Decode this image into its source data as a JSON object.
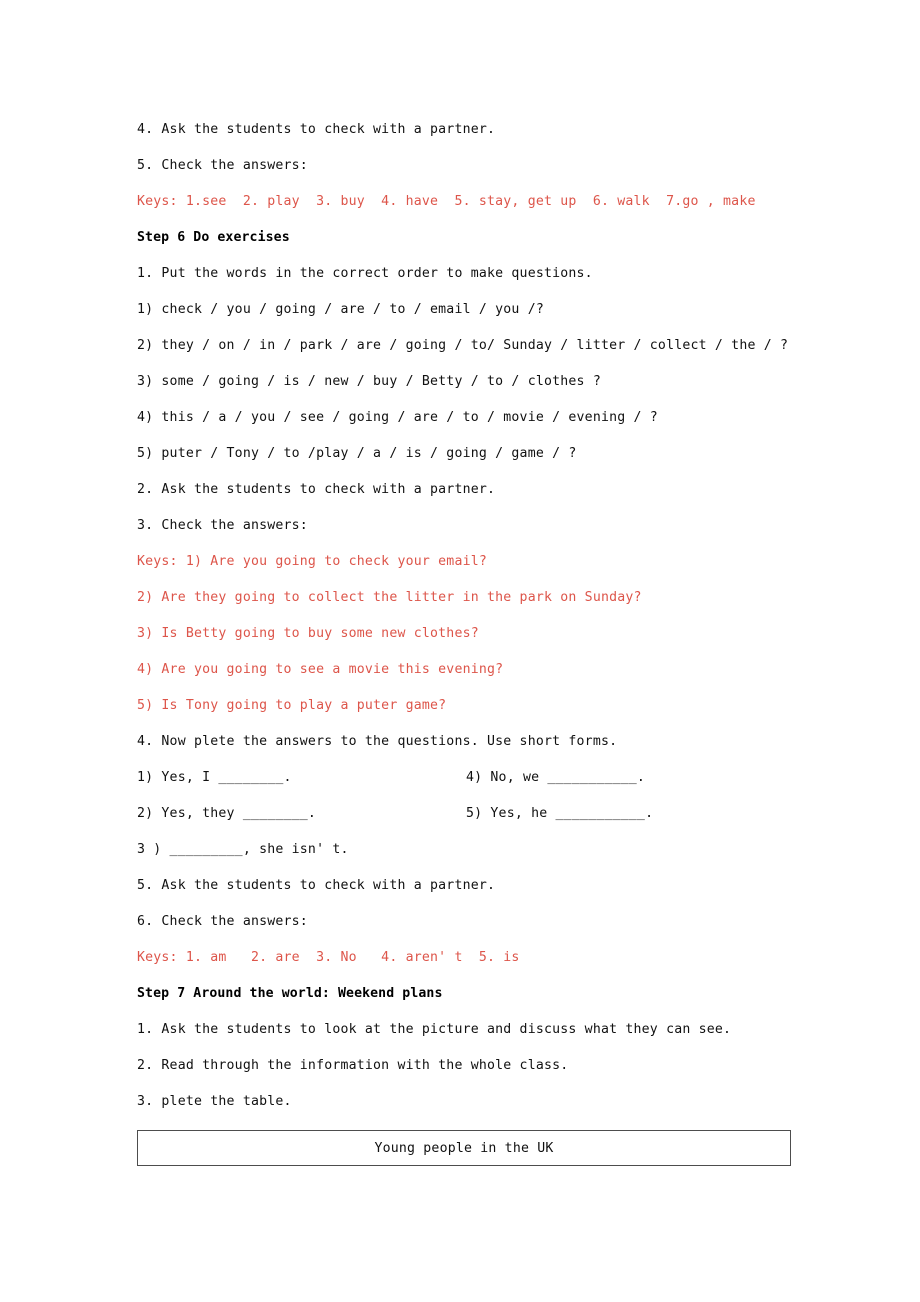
{
  "document": {
    "lines": [
      {
        "id": "l1",
        "text": "4. Ask the students to check with a partner.",
        "style": "plain"
      },
      {
        "id": "l2",
        "text": "5. Check the answers:",
        "style": "plain"
      },
      {
        "id": "l3",
        "text": "Keys: 1.see  2. play  3. buy  4. have  5. stay, get up  6. walk  7.go , make",
        "style": "red"
      },
      {
        "id": "l4",
        "text": "Step 6 Do exercises",
        "style": "bold"
      },
      {
        "id": "l5",
        "text": "1. Put the words in the correct order to make questions.",
        "style": "plain"
      },
      {
        "id": "l6",
        "text": "1) check / you / going / are / to / email / you /?",
        "style": "plain"
      },
      {
        "id": "l7",
        "text": "2) they / on / in / park / are / going / to/ Sunday / litter / collect / the / ?",
        "style": "plain"
      },
      {
        "id": "l8",
        "text": "3) some / going / is / new / buy / Betty / to / clothes ?",
        "style": "plain"
      },
      {
        "id": "l9",
        "text": "4) this / a / you / see / going / are / to / movie / evening / ?",
        "style": "plain"
      },
      {
        "id": "l10",
        "text": "5) puter / Tony / to /play / a / is / going / game / ?",
        "style": "plain"
      },
      {
        "id": "l11",
        "text": "2. Ask the students to check with a partner.",
        "style": "plain"
      },
      {
        "id": "l12",
        "text": "3. Check the answers:",
        "style": "plain"
      },
      {
        "id": "l13",
        "text": "Keys: 1) Are you going to check your email?",
        "style": "red"
      },
      {
        "id": "l14",
        "text": "2) Are they going to collect the litter in the park on Sunday?",
        "style": "red"
      },
      {
        "id": "l15",
        "text": "3) Is Betty going to buy some new clothes?",
        "style": "red"
      },
      {
        "id": "l16",
        "text": "4) Are you going to see a movie this evening?",
        "style": "red"
      },
      {
        "id": "l17",
        "text": "5) Is Tony going to play a puter game?",
        "style": "red"
      },
      {
        "id": "l18",
        "text": "4. Now plete the answers to the questions. Use short forms.",
        "style": "plain"
      }
    ],
    "answer_rows": [
      {
        "id": "r1",
        "left": "1) Yes, I ________.",
        "right": "4) No, we ___________."
      },
      {
        "id": "r2",
        "left": "2) Yes, they ________.",
        "right": "5) Yes, he ___________."
      },
      {
        "id": "r3",
        "left": "3 ) _________, she isn' t.",
        "right": ""
      }
    ],
    "lines_after": [
      {
        "id": "l19",
        "text": "5. Ask the students to check with a partner.",
        "style": "plain"
      },
      {
        "id": "l20",
        "text": "6. Check the answers:",
        "style": "plain"
      },
      {
        "id": "l21",
        "text": "Keys: 1. am   2. are  3. No   4. aren' t  5. is",
        "style": "red"
      },
      {
        "id": "l22",
        "text": "Step 7 Around the world: Weekend plans",
        "style": "bold"
      },
      {
        "id": "l23",
        "text": "1. Ask the students to look at the picture and discuss what they can see.",
        "style": "plain"
      },
      {
        "id": "l24",
        "text": "2. Read through the information with the whole class.",
        "style": "plain"
      },
      {
        "id": "l25",
        "text": "3. plete the table.",
        "style": "plain"
      }
    ],
    "table": {
      "header_cell": "Young people in the UK"
    },
    "colors": {
      "body_text": "#111111",
      "keys_red": "#dd554a",
      "table_border": "#4d4d4d",
      "page_background": "#ffffff"
    }
  }
}
